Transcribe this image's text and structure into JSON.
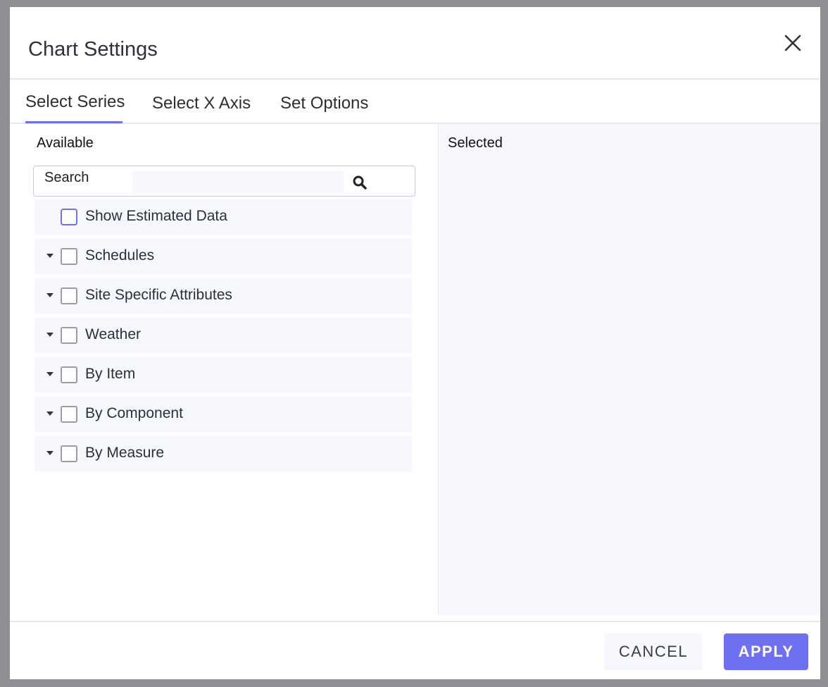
{
  "dialog": {
    "title": "Chart Settings"
  },
  "tabs": [
    {
      "label": "Select Series"
    },
    {
      "label": "Select X Axis"
    },
    {
      "label": "Set Options"
    }
  ],
  "available": {
    "label": "Available",
    "search": {
      "label": "Search",
      "value": ""
    },
    "items": [
      {
        "label": "Show Estimated Data"
      },
      {
        "label": "Schedules"
      },
      {
        "label": "Site Specific Attributes"
      },
      {
        "label": "Weather"
      },
      {
        "label": "By Item"
      },
      {
        "label": "By Component"
      },
      {
        "label": "By Measure"
      }
    ]
  },
  "selected": {
    "label": "Selected"
  },
  "footer": {
    "cancel_label": "CANCEL",
    "apply_label": "APPLY"
  },
  "colors": {
    "accent": "#6f6ff2",
    "pane_bg": "#f7f8fd",
    "backdrop": "#8f8f93"
  }
}
